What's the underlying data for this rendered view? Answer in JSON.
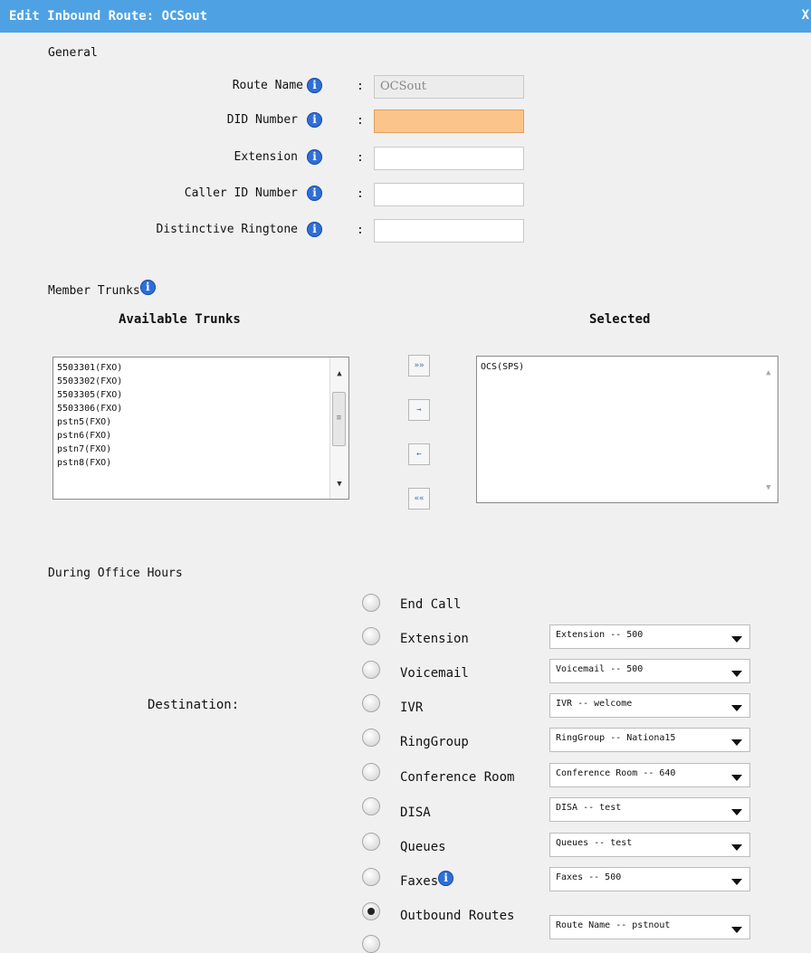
{
  "window": {
    "title": "Edit Inbound Route: OCSout",
    "close_label": "X"
  },
  "general": {
    "heading": "General",
    "colon": ":",
    "route_name_label": "Route Name",
    "route_name_value": "OCSout",
    "did_label": "DID Number",
    "did_value": "",
    "extension_label": "Extension",
    "extension_value": "",
    "caller_id_label": "Caller ID Number",
    "caller_id_value": "",
    "ringtone_label": "Distinctive Ringtone",
    "ringtone_value": "",
    "info_glyph": "i"
  },
  "trunks": {
    "heading": "Member Trunks",
    "available_title": "Available Trunks",
    "selected_title": "Selected",
    "available": [
      "5503301(FXO)",
      "5503302(FXO)",
      "5503305(FXO)",
      "5503306(FXO)",
      "pstn5(FXO)",
      "pstn6(FXO)",
      "pstn7(FXO)",
      "pstn8(FXO)"
    ],
    "selected": [
      "OCS(SPS)"
    ],
    "buttons": {
      "add_all": "»»",
      "add": "→",
      "remove": "←",
      "remove_all": "««"
    }
  },
  "office_hours": {
    "heading": "During Office Hours",
    "destination_label": "Destination:",
    "options": [
      {
        "label": "End Call",
        "value": ""
      },
      {
        "label": "Extension",
        "value": "Extension -- 500"
      },
      {
        "label": "Voicemail",
        "value": "Voicemail -- 500"
      },
      {
        "label": "IVR",
        "value": "IVR -- welcome"
      },
      {
        "label": "RingGroup",
        "value": "RingGroup -- Nationa15"
      },
      {
        "label": "Conference Room",
        "value": "Conference Room -- 640"
      },
      {
        "label": "DISA",
        "value": "DISA -- test"
      },
      {
        "label": "Queues",
        "value": "Queues -- test"
      },
      {
        "label": "Faxes",
        "value": "Faxes -- 500"
      },
      {
        "label": "Outbound Routes",
        "value": "Route Name -- pstnout"
      }
    ],
    "selected_option": "Outbound Routes"
  },
  "icons": {
    "info": "info-icon",
    "radio": "radio-button",
    "dropdown": "chevron-down-icon"
  },
  "colors": {
    "titlebar": "#4ea2e3",
    "did_highlight": "#fbc48a",
    "info_icon": "#2f6fd6"
  }
}
